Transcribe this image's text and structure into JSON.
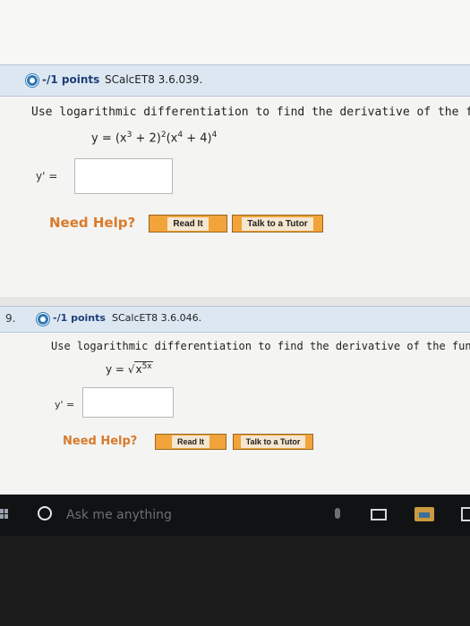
{
  "question1": {
    "points": "-/1 points",
    "source": "SCalcET8 3.6.039.",
    "instruction": "Use logarithmic differentiation to find the derivative of the functi",
    "equation": {
      "lhs": "y = (x",
      "exp1": "3",
      "mid1": " + 2)",
      "exp2": "2",
      "mid2": "(x",
      "exp3": "4",
      "mid3": " + 4)",
      "exp4": "4"
    },
    "answer_label": "y' =",
    "answer_value": ""
  },
  "question2": {
    "number": "9.",
    "points": "-/1 points",
    "source": "SCalcET8 3.6.046.",
    "instruction": "Use logarithmic differentiation to find the derivative of the function.",
    "equation": {
      "lhs": "y = ",
      "radical": "√",
      "radicand": "x",
      "exponent": "5x"
    },
    "answer_label": "y' =",
    "answer_value": ""
  },
  "help": {
    "need_help": "Need Help?",
    "read_it": "Read It",
    "talk_to_tutor": "Talk to a Tutor"
  },
  "taskbar": {
    "search_placeholder": "Ask me anything"
  },
  "colors": {
    "header_bg": "#dce7f1",
    "accent": "#2f78b6",
    "help_text": "#d97a2b",
    "button_bg": "#f2a33a",
    "taskbar_bg": "#111214"
  }
}
